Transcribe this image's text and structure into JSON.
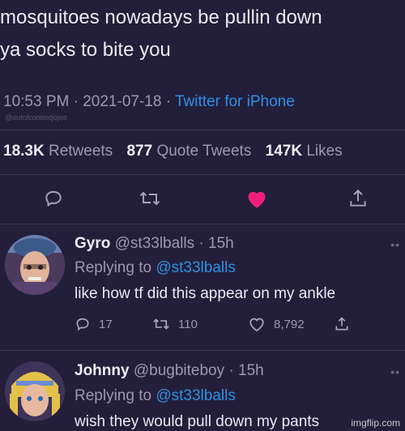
{
  "tweet": {
    "text_line1": "mosquitoes nowadays be pullin down",
    "text_line2": "ya socks to bite you",
    "time": "10:53 PM",
    "date": "2021-07-18",
    "source": "Twitter for iPhone",
    "watermark": "@outofcontextjojos"
  },
  "stats": {
    "retweets_count": "18.3K",
    "retweets_label": "Retweets",
    "quotes_count": "877",
    "quotes_label": "Quote Tweets",
    "likes_count": "147K",
    "likes_label": "Likes"
  },
  "actions": {
    "icons": [
      "reply-icon",
      "retweet-icon",
      "like-icon",
      "share-icon"
    ],
    "like_color": "#f0207a"
  },
  "replies": [
    {
      "name": "Gyro",
      "handle": "@st33lballs",
      "time": "15h",
      "replying_prefix": "Replying to",
      "replying_to": "@st33lballs",
      "body": "like how tf did this appear on my ankle",
      "reply_count": "17",
      "retweet_count": "110",
      "like_count": "8,792"
    },
    {
      "name": "Johnny",
      "handle": "@bugbiteboy",
      "time": "15h",
      "replying_prefix": "Replying to",
      "replying_to": "@st33lballs",
      "body": "wish they would pull down my pants"
    }
  ],
  "footer": {
    "imgflip": "imgflip.com"
  },
  "colors": {
    "background": "#231f3a",
    "accent": "#2f8fe6",
    "muted": "#9d99ad"
  }
}
